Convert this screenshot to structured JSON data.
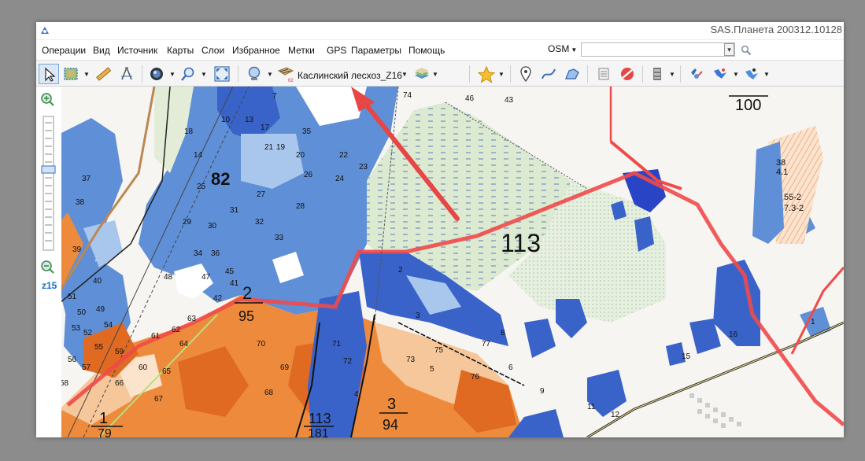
{
  "app": {
    "title": "SAS.Планета 200312.10128"
  },
  "menu": {
    "items": [
      "Операции",
      "Вид",
      "Источник",
      "Карты",
      "Слои",
      "Избранное",
      "Метки",
      "GPS",
      "Параметры",
      "Помощь"
    ]
  },
  "search": {
    "map_source": "OSM",
    "query": ""
  },
  "toolbar": {
    "layer_name": "Каслинский лесхоз_Z16"
  },
  "zoom": {
    "level": "z15"
  },
  "map_labels": {
    "big_113": "113",
    "big_82": "82",
    "frac_200_bottom": "100",
    "frac_2": "2",
    "frac_95": "95",
    "frac_1": "1",
    "frac_79": "79",
    "frac_113b": "113",
    "frac_181": "181",
    "frac_3": "3",
    "frac_94": "94",
    "right_38": "38",
    "right_41": "4.1",
    "right_552": "55-2",
    "right_732": "7.3-2",
    "small": [
      "74",
      "46",
      "43",
      "18",
      "10",
      "13",
      "17",
      "14",
      "7",
      "21",
      "19",
      "20",
      "22",
      "23",
      "24",
      "26",
      "25",
      "27",
      "28",
      "29",
      "30",
      "31",
      "32",
      "33",
      "34",
      "35",
      "36",
      "37",
      "38",
      "39",
      "40",
      "41",
      "42",
      "45",
      "47",
      "48",
      "49",
      "50",
      "51",
      "52",
      "53",
      "54",
      "55",
      "56",
      "57",
      "58",
      "59",
      "60",
      "61",
      "62",
      "63",
      "64",
      "65",
      "66",
      "67",
      "68",
      "69",
      "70",
      "71",
      "72",
      "73",
      "75",
      "76",
      "77",
      "8",
      "9",
      "11",
      "12",
      "15",
      "16",
      "1",
      "2",
      "3",
      "4",
      "5",
      "6"
    ]
  },
  "colors": {
    "dark_blue": "#3a63c9",
    "mid_blue": "#5f8fd6",
    "light_blue": "#a9c6ec",
    "pale_blue": "#d7e6f7",
    "orange": "#ee8a3c",
    "dark_orange": "#e06a22",
    "light_orange": "#f6c79a",
    "pale_orange": "#fbe3cc",
    "green": "#dde9d2",
    "red_line": "#f04a4a",
    "arrow": "#e84545"
  }
}
